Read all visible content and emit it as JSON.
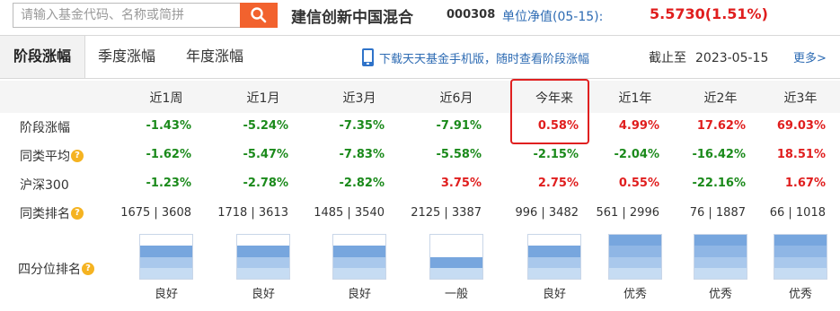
{
  "search": {
    "placeholder": "请输入基金代码、名称或简拼"
  },
  "fund": {
    "name": "建信创新中国混合",
    "code": "000308",
    "nav_label": "单位净值(05-15):",
    "nav_value": "5.5730(1.51%)"
  },
  "tabs": [
    {
      "label": "阶段涨幅",
      "active": true
    },
    {
      "label": "季度涨幅",
      "active": false
    },
    {
      "label": "年度涨幅",
      "active": false
    }
  ],
  "download_text": "下载天天基金手机版，随时查看阶段涨幅",
  "asof_label": "截止至",
  "asof_date": "2023-05-15",
  "more_label": "更多>",
  "columns": [
    "近1周",
    "近1月",
    "近3月",
    "近6月",
    "今年来",
    "近1年",
    "近2年",
    "近3年"
  ],
  "rows": [
    {
      "label": "阶段涨幅",
      "has_icon": false,
      "values": [
        "-1.43%",
        "-5.24%",
        "-7.35%",
        "-7.91%",
        "0.58%",
        "4.99%",
        "17.62%",
        "69.03%"
      ]
    },
    {
      "label": "同类平均",
      "has_icon": true,
      "values": [
        "-1.62%",
        "-5.47%",
        "-7.83%",
        "-5.58%",
        "-2.15%",
        "-2.04%",
        "-16.42%",
        "18.51%"
      ]
    },
    {
      "label": "沪深300",
      "has_icon": false,
      "values": [
        "-1.23%",
        "-2.78%",
        "-2.82%",
        "3.75%",
        "2.75%",
        "0.55%",
        "-22.16%",
        "1.67%"
      ]
    }
  ],
  "rank_row": {
    "label": "同类排名",
    "values": [
      "1675 | 3608",
      "1718 | 3613",
      "1485 | 3540",
      "2125 | 3387",
      "996 | 3482",
      "561 | 2996",
      "76 | 1887",
      "66 | 1018"
    ]
  },
  "quartile_row": {
    "label": "四分位排名",
    "levels": [
      3,
      3,
      3,
      2,
      3,
      4,
      4,
      4
    ],
    "labels": [
      "良好",
      "良好",
      "良好",
      "一般",
      "良好",
      "优秀",
      "优秀",
      "优秀"
    ]
  },
  "colors": {
    "accent_orange": "#f2622e",
    "link_blue": "#2d6bb3",
    "positive_red": "#e01e1e",
    "negative_green": "#1b8a1b",
    "highlight_red": "#e02020"
  },
  "icons": {
    "search": "search-icon",
    "phone": "phone-icon",
    "question": "question-icon"
  }
}
